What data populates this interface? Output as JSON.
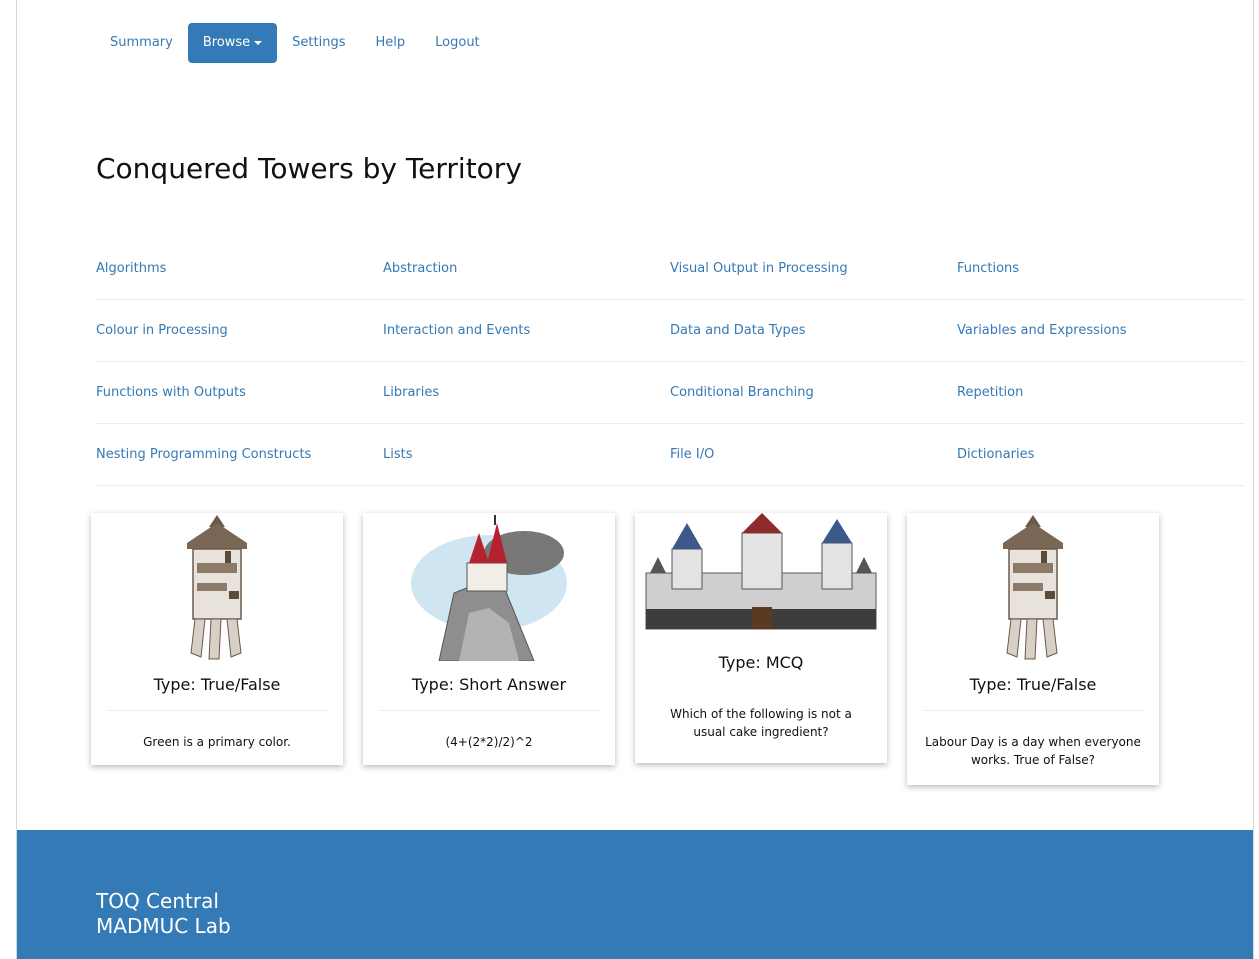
{
  "nav": {
    "items": [
      {
        "label": "Summary"
      },
      {
        "label": "Browse"
      },
      {
        "label": "Settings"
      },
      {
        "label": "Help"
      },
      {
        "label": "Logout"
      }
    ]
  },
  "page_title": "Conquered Towers by Territory",
  "territories": [
    [
      "Algorithms",
      "Abstraction",
      "Visual Output in Processing",
      "Functions"
    ],
    [
      "Colour in Processing",
      "Interaction and Events",
      "Data and Data Types",
      "Variables and Expressions"
    ],
    [
      "Functions with Outputs",
      "Libraries",
      "Conditional Branching",
      "Repetition"
    ],
    [
      "Nesting Programming Constructs",
      "Lists",
      "File I/O",
      "Dictionaries"
    ]
  ],
  "cards": [
    {
      "image": "tower-image",
      "type": "Type: True/False",
      "question": "Green is a primary color."
    },
    {
      "image": "cliff-castle-image",
      "type": "Type: Short Answer",
      "question": "(4+(2*2)/2)^2"
    },
    {
      "image": "fortress-image",
      "type": "Type: MCQ",
      "question": "Which of the following is not a usual cake ingredient?"
    },
    {
      "image": "tower-image",
      "type": "Type: True/False",
      "question": "Labour Day is a day when everyone works. True of False?"
    }
  ],
  "footer": {
    "line1": "TOQ Central",
    "line2": "MADMUC Lab"
  },
  "colors": {
    "accent": "#337ab7",
    "footer_bg": "#337ab7"
  }
}
